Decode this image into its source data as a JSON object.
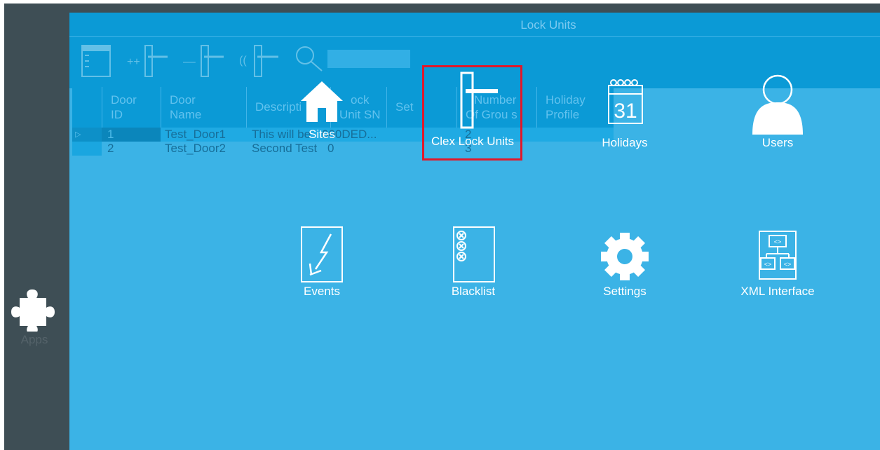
{
  "sidebar": {
    "apps_label": "Apps"
  },
  "window": {
    "title": "Lock Units",
    "columns": [
      "Door ID",
      "Door Name",
      "Description",
      "Lock Unit SN",
      "Settings",
      "Number Of Groups",
      "Holiday Profile"
    ],
    "column_lines": [
      [
        "Door",
        "ID"
      ],
      [
        "Door",
        "Name"
      ],
      [
        "Descripti",
        ""
      ],
      [
        "ock",
        "Unit SN"
      ],
      [
        "Set",
        ""
      ],
      [
        "Number",
        "Of Grou s"
      ],
      [
        "Holiday",
        "Profile"
      ]
    ],
    "rows": [
      {
        "door_id": "1",
        "door_name": "Test_Door1",
        "description": "This will be",
        "lock_unit_sn": "000DED...",
        "groups": "2"
      },
      {
        "door_id": "2",
        "door_name": "Test_Door2",
        "description": "Second Test",
        "lock_unit_sn": "0",
        "groups": "3"
      }
    ]
  },
  "launcher": {
    "tiles": [
      {
        "label": "Sites",
        "icon": "home-icon"
      },
      {
        "label": "Clex Lock Units",
        "icon": "lock-unit-icon"
      },
      {
        "label": "Holidays",
        "icon": "calendar-icon",
        "calendar_day": "31"
      },
      {
        "label": "Users",
        "icon": "user-icon"
      },
      {
        "label": "Events",
        "icon": "events-icon"
      },
      {
        "label": "Blacklist",
        "icon": "blacklist-icon"
      },
      {
        "label": "Settings",
        "icon": "gear-icon"
      },
      {
        "label": "XML Interface",
        "icon": "xml-interface-icon"
      }
    ],
    "highlighted_tile": "Clex Lock Units"
  },
  "colors": {
    "sidebar_bg": "#3e4e55",
    "main_bg": "#3bb3e6",
    "toolbar_bg": "#0b9ad6",
    "highlight_border": "#e2182a"
  }
}
